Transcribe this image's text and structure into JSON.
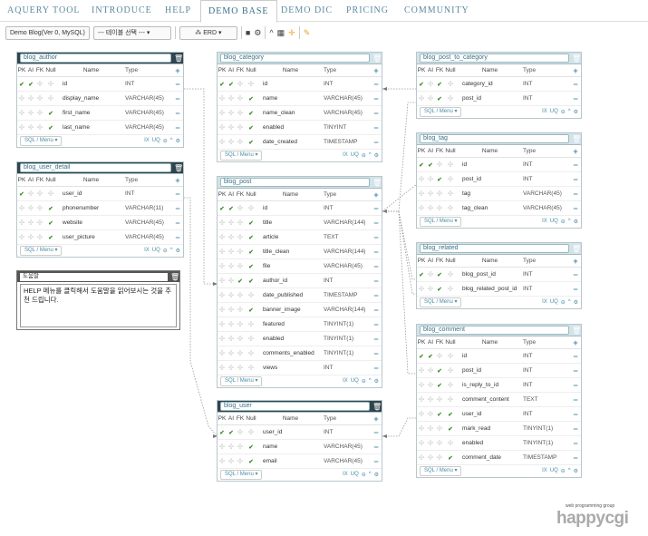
{
  "nav": {
    "tabs": [
      "AQUERY TOOL",
      "INTRODUCE",
      "HELP",
      "DEMO BASE",
      "DEMO DIC",
      "PRICING",
      "COMMUNITY"
    ],
    "active": "DEMO BASE"
  },
  "toolbar": {
    "db_select": "Demo Blog(Ver 0, MySQL)",
    "table_select": "--- 테이블 선택 ---",
    "erd_button": "ERD",
    "accent_color": "#f0a020"
  },
  "column_headers": {
    "pk": "PK",
    "ai": "AI",
    "fk": "FK",
    "null": "Null",
    "name": "Name",
    "type": "Type"
  },
  "footer": {
    "menu": "SQL / Menu",
    "ix": "IX",
    "uq": "UQ"
  },
  "tables": {
    "blog_author": {
      "title": "blog_author",
      "rows": [
        {
          "name": "id",
          "type": "INT"
        },
        {
          "name": "display_name",
          "type": "VARCHAR(45)"
        },
        {
          "name": "first_name",
          "type": "VARCHAR(45)"
        },
        {
          "name": "last_name",
          "type": "VARCHAR(45)"
        }
      ]
    },
    "blog_user_detail": {
      "title": "blog_user_detail",
      "rows": [
        {
          "name": "user_id",
          "type": "INT"
        },
        {
          "name": "phonenumber",
          "type": "VARCHAR(11)"
        },
        {
          "name": "website",
          "type": "VARCHAR(45)"
        },
        {
          "name": "user_picture",
          "type": "VARCHAR(45)"
        }
      ]
    },
    "blog_category": {
      "title": "blog_category",
      "rows": [
        {
          "name": "id",
          "type": "INT"
        },
        {
          "name": "name",
          "type": "VARCHAR(45)"
        },
        {
          "name": "name_clean",
          "type": "VARCHAR(45)"
        },
        {
          "name": "enabled",
          "type": "TINYINT"
        },
        {
          "name": "date_created",
          "type": "TIMESTAMP"
        }
      ]
    },
    "blog_post": {
      "title": "blog_post",
      "rows": [
        {
          "name": "id",
          "type": "INT"
        },
        {
          "name": "title",
          "type": "VARCHAR(144)"
        },
        {
          "name": "article",
          "type": "TEXT"
        },
        {
          "name": "title_clean",
          "type": "VARCHAR(144)"
        },
        {
          "name": "file",
          "type": "VARCHAR(45)"
        },
        {
          "name": "author_id",
          "type": "INT"
        },
        {
          "name": "date_published",
          "type": "TIMESTAMP"
        },
        {
          "name": "banner_image",
          "type": "VARCHAR(144)"
        },
        {
          "name": "featured",
          "type": "TINYINT(1)"
        },
        {
          "name": "enabled",
          "type": "TINYINT(1)"
        },
        {
          "name": "comments_enabled",
          "type": "TINYINT(1)"
        },
        {
          "name": "views",
          "type": "INT"
        }
      ]
    },
    "blog_user": {
      "title": "blog_user",
      "rows": [
        {
          "name": "user_id",
          "type": "INT"
        },
        {
          "name": "name",
          "type": "VARCHAR(45)"
        },
        {
          "name": "email",
          "type": "VARCHAR(45)"
        }
      ]
    },
    "blog_post_to_category": {
      "title": "blog_post_to_category",
      "rows": [
        {
          "name": "category_id",
          "type": "INT"
        },
        {
          "name": "post_id",
          "type": "INT"
        }
      ]
    },
    "blog_tag": {
      "title": "blog_tag",
      "rows": [
        {
          "name": "id",
          "type": "INT"
        },
        {
          "name": "post_id",
          "type": "INT"
        },
        {
          "name": "tag",
          "type": "VARCHAR(45)"
        },
        {
          "name": "tag_clean",
          "type": "VARCHAR(45)"
        }
      ]
    },
    "blog_related": {
      "title": "blog_related",
      "rows": [
        {
          "name": "blog_post_id",
          "type": "INT"
        },
        {
          "name": "blog_related_post_id",
          "type": "INT"
        }
      ]
    },
    "blog_comment": {
      "title": "blog_comment",
      "rows": [
        {
          "name": "id",
          "type": "INT"
        },
        {
          "name": "post_id",
          "type": "INT"
        },
        {
          "name": "is_reply_to_id",
          "type": "INT"
        },
        {
          "name": "comment_content",
          "type": "TEXT"
        },
        {
          "name": "user_id",
          "type": "INT"
        },
        {
          "name": "mark_read",
          "type": "TINYINT(1)"
        },
        {
          "name": "enabled",
          "type": "TINYINT(1)"
        },
        {
          "name": "comment_date",
          "type": "TIMESTAMP"
        }
      ]
    }
  },
  "help": {
    "title": "도움말",
    "body": "HELP 메뉴를 클릭해서 도움말을 읽어보시는 것을 추천 드립니다."
  },
  "logo": {
    "tagline": "web programming group",
    "name": "happycgi"
  }
}
